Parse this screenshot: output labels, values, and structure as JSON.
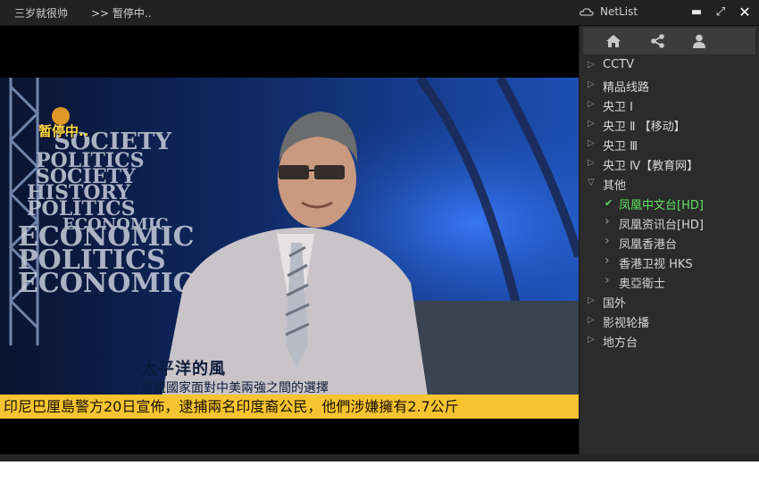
{
  "app": {
    "title": "三岁就很帅",
    "status": ">> 暂停中.."
  },
  "panel": {
    "title": "NetList"
  },
  "window_controls": {
    "minimize": "▬",
    "maximize": "⤢",
    "close": "✕"
  },
  "video": {
    "pause_overlay": "暂停中..",
    "program_title": "太平洋的風",
    "program_subtitle": "東盟國家面對中美兩強之間的選擇",
    "ticker": "印尼巴厘島警方20日宣佈，逮捕兩名印度裔公民，他們涉嫌擁有2.7公斤",
    "backdrop_words": [
      "SOCIETY",
      "POLITICS",
      "SOCIETY",
      "HISTORY",
      "POLITICS",
      "ECONOMIC",
      "ECONOMIC",
      "POLITICS",
      "ECONOMIC"
    ]
  },
  "tabs": [
    {
      "name": "home-icon"
    },
    {
      "name": "share-icon"
    },
    {
      "name": "user-icon"
    }
  ],
  "channels": [
    {
      "label": "CCTV",
      "state": "collapsed",
      "level": 0
    },
    {
      "label": "精品线路",
      "state": "collapsed",
      "level": 0
    },
    {
      "label": "央卫 Ⅰ",
      "state": "collapsed",
      "level": 0
    },
    {
      "label": "央卫 Ⅱ 【移动】",
      "state": "collapsed",
      "level": 0
    },
    {
      "label": "央卫 Ⅲ",
      "state": "collapsed",
      "level": 0
    },
    {
      "label": "央卫 Ⅳ【教育网】",
      "state": "collapsed",
      "level": 0
    },
    {
      "label": "其他",
      "state": "expanded",
      "level": 0
    },
    {
      "label": "凤凰中文台[HD]",
      "state": "selected",
      "level": 1
    },
    {
      "label": "凤凰资讯台[HD]",
      "state": "collapsed",
      "level": 1
    },
    {
      "label": "凤凰香港台",
      "state": "collapsed",
      "level": 1
    },
    {
      "label": "香港卫视 HKS",
      "state": "collapsed",
      "level": 1
    },
    {
      "label": "奥亞衛士",
      "state": "collapsed",
      "level": 1
    },
    {
      "label": "国外",
      "state": "collapsed",
      "level": 0
    },
    {
      "label": "影视轮播",
      "state": "collapsed",
      "level": 0
    },
    {
      "label": "地方台",
      "state": "collapsed",
      "level": 0
    }
  ],
  "colors": {
    "selected": "#5fe35f",
    "ticker": "#f6c430",
    "pause": "#ffd94a"
  }
}
